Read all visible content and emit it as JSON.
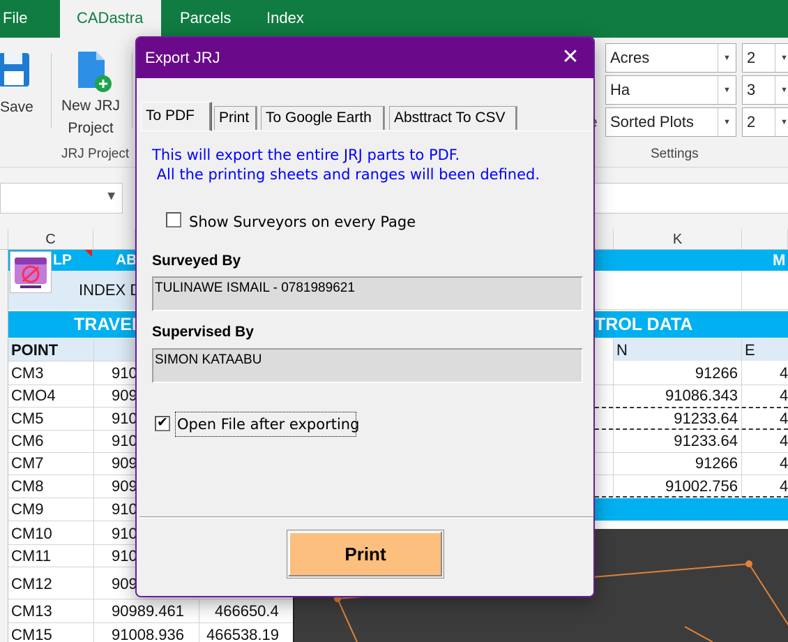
{
  "ribbon": {
    "tabs": [
      "File",
      "CADastra",
      "Parcels",
      "Index"
    ],
    "active_tab": "CADastra",
    "save_label": "Save",
    "new_project_label_1": "New JRJ",
    "new_project_label_2": "Project",
    "group_label_project": "JRJ Project",
    "group_label_settings": "Settings",
    "stray_e": "e",
    "settings": [
      {
        "unit": "Acres",
        "decimals": "2"
      },
      {
        "unit": "Ha",
        "decimals": "3"
      },
      {
        "unit": "Sorted Plots",
        "decimals": "2"
      }
    ]
  },
  "sheet": {
    "columns": {
      "c": "C",
      "k": "K"
    },
    "header_lp": "LP",
    "header_ab": "AB",
    "header_m": "M",
    "index_label": "INDEX D",
    "band_traverse": "TRAVEI",
    "band_control": "TROL DATA",
    "col_point": "POINT",
    "col_n": "N",
    "col_e": "E",
    "rows": [
      {
        "point": "CM3",
        "b": "910",
        "n": "91266",
        "e": "4"
      },
      {
        "point": "CMO4",
        "b": "909",
        "n": "91086.343",
        "e": "4"
      },
      {
        "point": "CM5",
        "b": "910",
        "n": "91233.64",
        "e": "4"
      },
      {
        "point": "CM6",
        "b": "910",
        "n": "91233.64",
        "e": "4"
      },
      {
        "point": "CM7",
        "b": "909",
        "n": "91266",
        "e": "4"
      },
      {
        "point": "CM8",
        "b": "909",
        "n": "91002.756",
        "e": "4"
      },
      {
        "point": "CM9",
        "b": "910"
      },
      {
        "point": "CM10",
        "b": "910"
      },
      {
        "point": "CM11",
        "b": "910"
      },
      {
        "point": "CM12",
        "b": "909"
      },
      {
        "point": "CM13",
        "b": "90989.461",
        "c": "466650.4"
      },
      {
        "point": "CM15",
        "b": "91008.936",
        "c": "466538.19"
      }
    ]
  },
  "dialog": {
    "title": "Export JRJ",
    "tabs": [
      "To PDF",
      "Print",
      "To Google Earth",
      "Absttract To CSV"
    ],
    "active_tab": "To PDF",
    "info_line1": "This will export the entire JRJ parts to PDF.",
    "info_line2": " All the printing sheets and ranges will been defined.",
    "show_surveyors_label": "Show Surveyors on every Page",
    "show_surveyors_checked": false,
    "surveyed_by_label": "Surveyed By",
    "surveyed_by_value": "TULINAWE ISMAIL - 0781989621",
    "supervised_by_label": "Supervised By",
    "supervised_by_value": "SIMON KATAABU",
    "open_file_label": "Open File after exporting",
    "open_file_checked": true,
    "print_button": "Print",
    "colors": {
      "title_bar": "#6a0a8a",
      "print_button": "#fdbf7e",
      "info_text": "#0000ff"
    }
  }
}
